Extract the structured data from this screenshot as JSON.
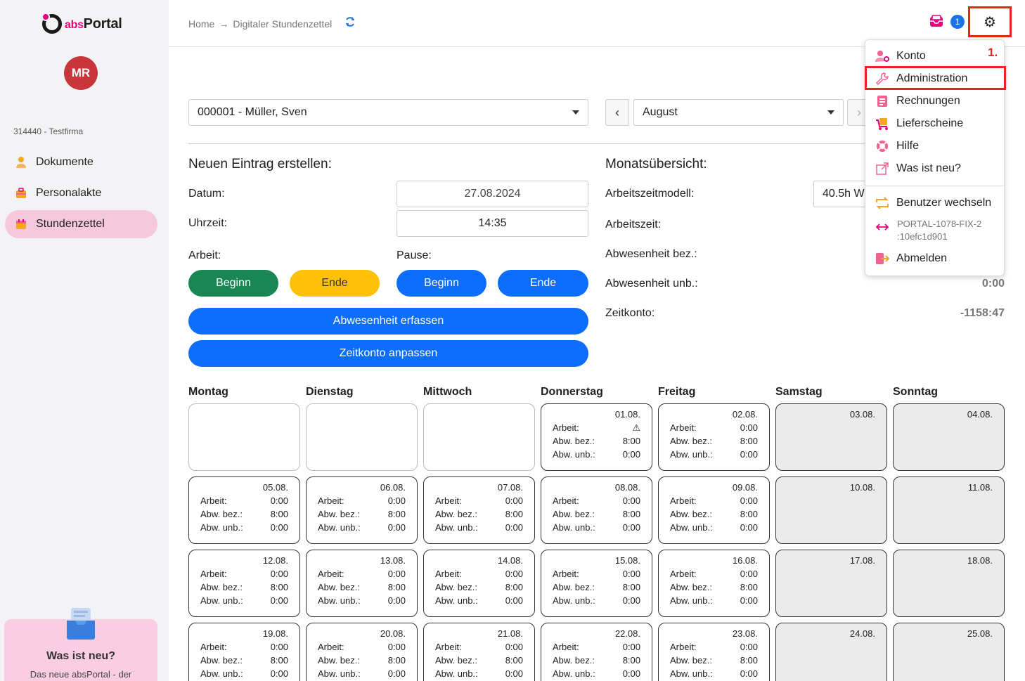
{
  "sidebar": {
    "logo_abs": "abs",
    "logo_portal": "Portal",
    "avatar_initials": "MR",
    "company": "314440 - Testfirma",
    "items": [
      {
        "label": "Dokumente",
        "icon": "person-icon"
      },
      {
        "label": "Personalakte",
        "icon": "briefcase-icon"
      },
      {
        "label": "Stundenzettel",
        "icon": "calendar-icon",
        "active": true
      }
    ],
    "promo_title": "Was ist neu?",
    "promo_text": "Das neue absPortal - der"
  },
  "header": {
    "breadcrumb_home": "Home",
    "breadcrumb_arrow": "→",
    "breadcrumb_current": "Digitaler Stundenzettel",
    "notification_count": "1",
    "gear_icon": "⚙"
  },
  "filters": {
    "employee": "000001 - Müller, Sven",
    "month": "August",
    "prev": "‹",
    "next": "›"
  },
  "entry": {
    "title": "Neuen Eintrag erstellen:",
    "date_label": "Datum:",
    "date_value": "27.08.2024",
    "time_label": "Uhrzeit:",
    "time_value": "14:35",
    "work_label": "Arbeit:",
    "pause_label": "Pause:",
    "work_begin": "Beginn",
    "work_end": "Ende",
    "pause_begin": "Beginn",
    "pause_end": "Ende",
    "absence_button": "Abwesenheit erfassen",
    "timeaccount_button": "Zeitkonto anpassen"
  },
  "overview": {
    "title": "Monatsübersicht:",
    "model_label": "Arbeitszeitmodell:",
    "model_value": "40.5h W",
    "worktime_label": "Arbeitszeit:",
    "abs_paid_label": "Abwesenheit bez.:",
    "abs_unpaid_label": "Abwesenheit unb.:",
    "abs_unpaid_value": "0:00",
    "account_label": "Zeitkonto:",
    "account_value": "-1158:47"
  },
  "calendar": {
    "days": [
      "Montag",
      "Dienstag",
      "Mittwoch",
      "Donnerstag",
      "Freitag",
      "Samstag",
      "Sonntag"
    ],
    "row_labels": {
      "work": "Arbeit:",
      "paid": "Abw. bez.:",
      "unpaid": "Abw. unb.:"
    },
    "weeks": [
      [
        null,
        null,
        null,
        {
          "date": "01.08.",
          "work": "⚠",
          "paid": "8:00",
          "unpaid": "0:00"
        },
        {
          "date": "02.08.",
          "work": "0:00",
          "paid": "8:00",
          "unpaid": "0:00"
        },
        {
          "date": "03.08.",
          "weekend": true
        },
        {
          "date": "04.08.",
          "weekend": true
        }
      ],
      [
        {
          "date": "05.08.",
          "work": "0:00",
          "paid": "8:00",
          "unpaid": "0:00"
        },
        {
          "date": "06.08.",
          "work": "0:00",
          "paid": "8:00",
          "unpaid": "0:00"
        },
        {
          "date": "07.08.",
          "work": "0:00",
          "paid": "8:00",
          "unpaid": "0:00"
        },
        {
          "date": "08.08.",
          "work": "0:00",
          "paid": "8:00",
          "unpaid": "0:00"
        },
        {
          "date": "09.08.",
          "work": "0:00",
          "paid": "8:00",
          "unpaid": "0:00"
        },
        {
          "date": "10.08.",
          "weekend": true
        },
        {
          "date": "11.08.",
          "weekend": true
        }
      ],
      [
        {
          "date": "12.08.",
          "work": "0:00",
          "paid": "8:00",
          "unpaid": "0:00"
        },
        {
          "date": "13.08.",
          "work": "0:00",
          "paid": "8:00",
          "unpaid": "0:00"
        },
        {
          "date": "14.08.",
          "work": "0:00",
          "paid": "8:00",
          "unpaid": "0:00"
        },
        {
          "date": "15.08.",
          "work": "0:00",
          "paid": "8:00",
          "unpaid": "0:00"
        },
        {
          "date": "16.08.",
          "work": "0:00",
          "paid": "8:00",
          "unpaid": "0:00"
        },
        {
          "date": "17.08.",
          "weekend": true
        },
        {
          "date": "18.08.",
          "weekend": true
        }
      ],
      [
        {
          "date": "19.08.",
          "work": "0:00",
          "paid": "8:00",
          "unpaid": "0:00"
        },
        {
          "date": "20.08.",
          "work": "0:00",
          "paid": "8:00",
          "unpaid": "0:00"
        },
        {
          "date": "21.08.",
          "work": "0:00",
          "paid": "8:00",
          "unpaid": "0:00"
        },
        {
          "date": "22.08.",
          "work": "0:00",
          "paid": "8:00",
          "unpaid": "0:00"
        },
        {
          "date": "23.08.",
          "work": "0:00",
          "paid": "8:00",
          "unpaid": "0:00"
        },
        {
          "date": "24.08.",
          "weekend": true
        },
        {
          "date": "25.08.",
          "weekend": true
        }
      ]
    ]
  },
  "menu": {
    "annotation": "1.",
    "items": {
      "konto": "Konto",
      "administration": "Administration",
      "rechnungen": "Rechnungen",
      "lieferscheine": "Lieferscheine",
      "hilfe": "Hilfe",
      "neu": "Was ist neu?",
      "switch_user": "Benutzer wechseln",
      "portal_line1": "PORTAL-1078-FIX-2",
      "portal_line2": ":10efc1d901",
      "logout": "Abmelden"
    }
  },
  "colors": {
    "accent": "#e7007e",
    "primary": "#0d6efd",
    "success": "#198754",
    "warning": "#ffc107",
    "highlight": "#e8251b"
  }
}
